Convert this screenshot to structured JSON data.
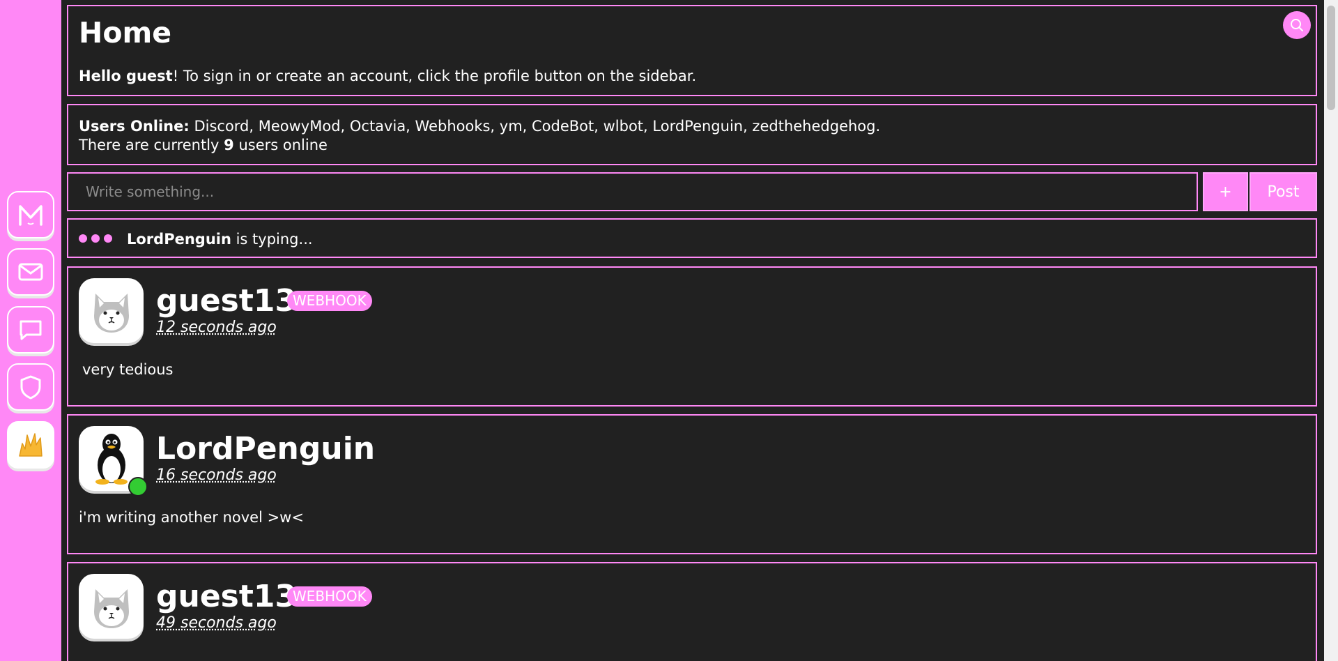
{
  "page": {
    "title": "Home",
    "greeting_bold": "Hello guest",
    "greeting_rest": "! To sign in or create an account, click the profile button on the sidebar."
  },
  "online": {
    "label": "Users Online:",
    "users": "Discord, MeowyMod, Octavia, Webhooks, ym, CodeBot, wlbot, LordPenguin, zedthehedgehog.",
    "count_prefix": "There are currently ",
    "count": "9",
    "count_suffix": " users online"
  },
  "composer": {
    "placeholder": "Write something...",
    "plus_label": "+",
    "post_label": "Post"
  },
  "typing": {
    "user": "LordPenguin",
    "text": " is typing..."
  },
  "sidebar": {
    "items": [
      {
        "icon": "meower-logo-icon"
      },
      {
        "icon": "mail-icon"
      },
      {
        "icon": "chat-icon"
      },
      {
        "icon": "shield-icon"
      },
      {
        "icon": "profile-icon"
      }
    ]
  },
  "posts": [
    {
      "username": "guest13",
      "badge": "WEBHOOK",
      "timestamp": "12 seconds ago",
      "content": "very tedious",
      "avatar": "cat-avatar"
    },
    {
      "username": "LordPenguin",
      "timestamp": "16 seconds ago",
      "content": "i'm writing another novel >w<",
      "avatar": "penguin-avatar",
      "online": true
    },
    {
      "username": "guest13",
      "badge": "WEBHOOK",
      "timestamp": "49 seconds ago",
      "content": "",
      "avatar": "cat-avatar"
    }
  ],
  "colors": {
    "accent": "#ff88f6",
    "background": "#212121",
    "online": "#33cc33"
  }
}
